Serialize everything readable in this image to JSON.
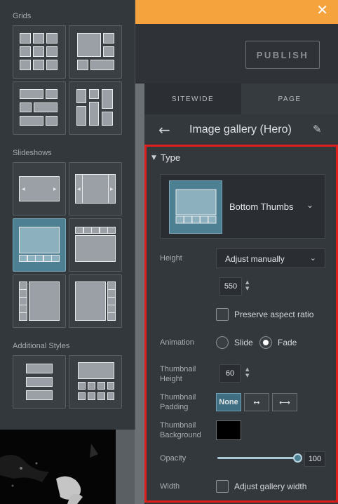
{
  "topbar": {
    "close_symbol": "✕",
    "accent_color": "#f5a33c"
  },
  "header": {
    "publish_label": "PUBLISH"
  },
  "tabs": {
    "sitewide": "SITEWIDE",
    "page": "PAGE"
  },
  "section": {
    "back_symbol": "←",
    "title": "Image gallery (Hero)",
    "edit_icon": "pencil-icon"
  },
  "type_group": {
    "label": "Type",
    "selected": "Bottom Thumbs"
  },
  "height": {
    "label": "Height",
    "mode": "Adjust manually",
    "value": "550"
  },
  "preserve": {
    "label": "Preserve aspect ratio",
    "checked": false
  },
  "animation": {
    "label": "Animation",
    "options": [
      "Slide",
      "Fade"
    ],
    "selected": "Fade"
  },
  "thumb_height": {
    "label": "Thumbnail Height",
    "value": "60"
  },
  "thumb_padding": {
    "label": "Thumbnail Padding",
    "options": [
      "None",
      "↔",
      "⟷"
    ],
    "selected": "None"
  },
  "thumb_bg": {
    "label": "Thumbnail Background",
    "color": "#000000"
  },
  "opacity": {
    "label": "Opacity",
    "value": "100",
    "fraction": 1.0
  },
  "width": {
    "label": "Width",
    "checkbox_label": "Adjust gallery width",
    "checked": false
  },
  "layouts": {
    "groups": [
      "Grids",
      "Slideshows",
      "Additional Styles"
    ]
  }
}
